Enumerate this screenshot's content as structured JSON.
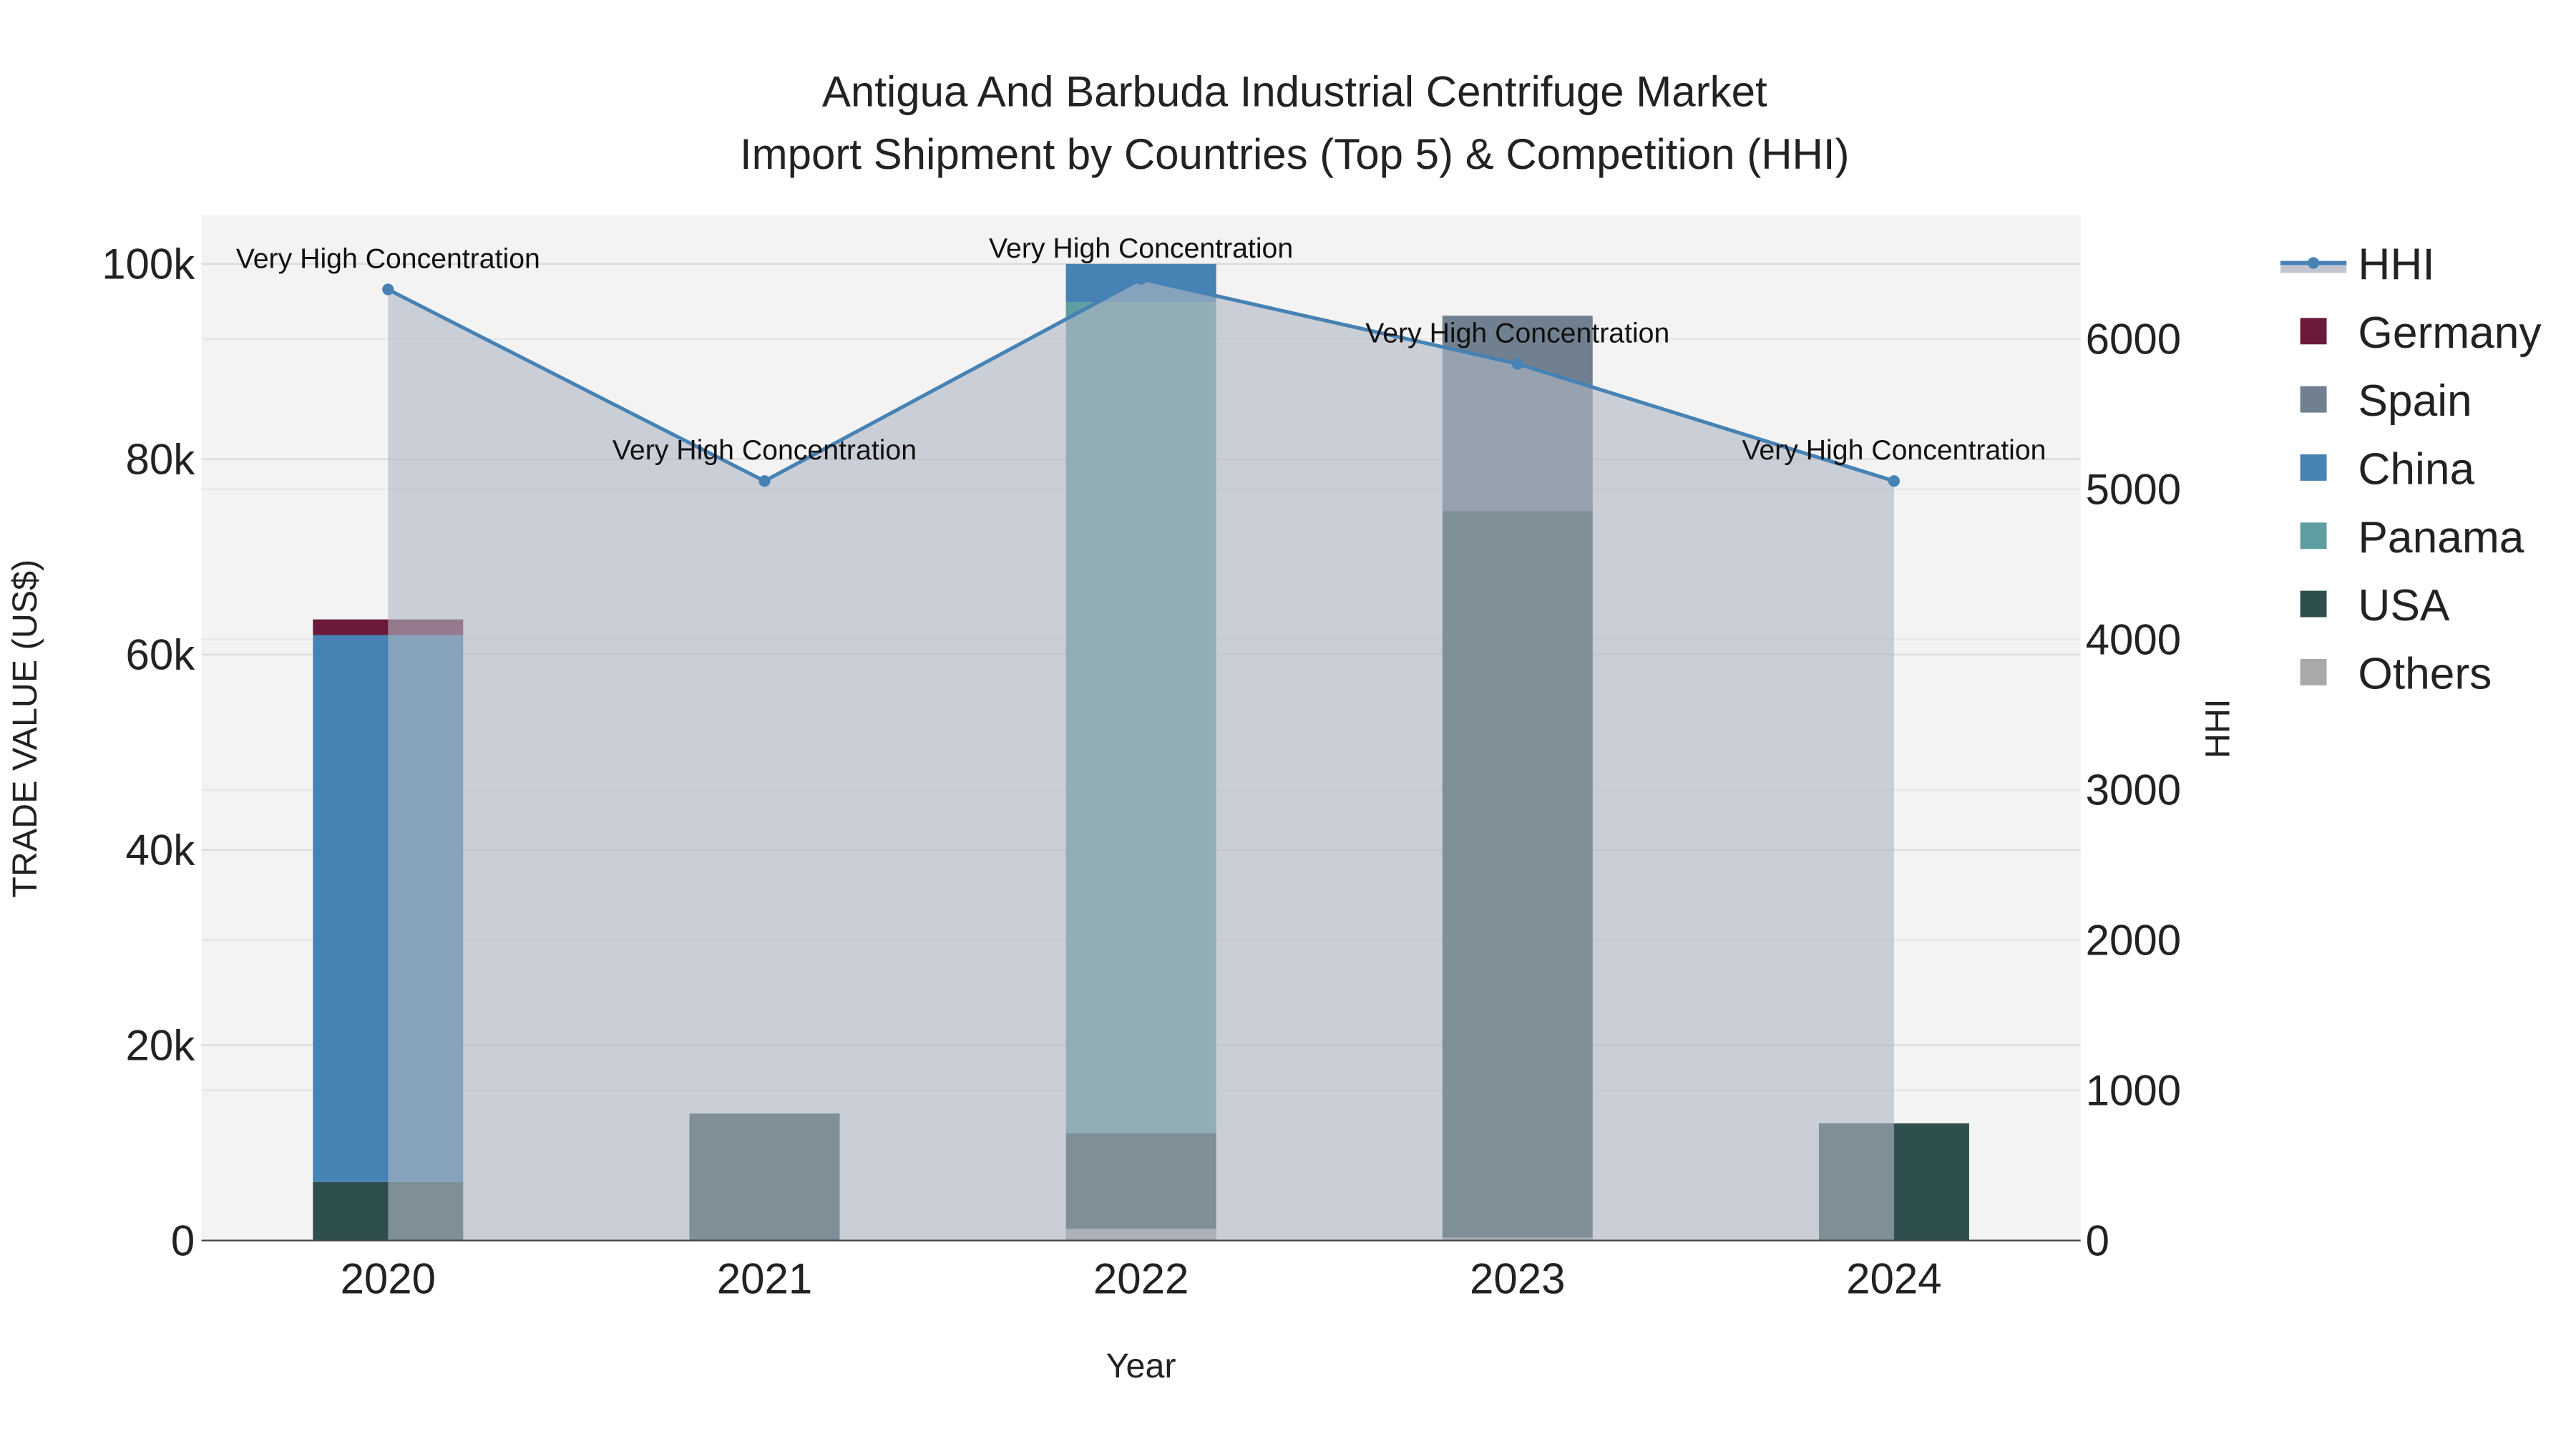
{
  "chart_data": {
    "type": "bar",
    "title_line1": "Antigua And Barbuda Industrial Centrifuge Market",
    "title_line2": "Import Shipment by Countries (Top 5) & Competition (HHI)",
    "xlabel": "Year",
    "ylabel": "TRADE VALUE (US$)",
    "y2label": "HHI",
    "categories": [
      "2020",
      "2021",
      "2022",
      "2023",
      "2024"
    ],
    "ylim": [
      0,
      105000
    ],
    "y2lim": [
      0,
      6825
    ],
    "yticks": [
      0,
      20000,
      40000,
      60000,
      80000,
      100000
    ],
    "ytick_labels": [
      "0",
      "20k",
      "40k",
      "60k",
      "80k",
      "100k"
    ],
    "y2ticks": [
      0,
      1000,
      2000,
      3000,
      4000,
      5000,
      6000
    ],
    "y2tick_labels": [
      "0",
      "1000",
      "2000",
      "3000",
      "4000",
      "5000",
      "6000"
    ],
    "stack_order": [
      "Others",
      "USA",
      "Panama",
      "China",
      "Spain",
      "Germany"
    ],
    "series": [
      {
        "name": "Germany",
        "color": "#6b1a3c",
        "values": [
          1600,
          0,
          0,
          0,
          0
        ]
      },
      {
        "name": "Spain",
        "color": "#708090",
        "values": [
          0,
          0,
          0,
          20000,
          0
        ]
      },
      {
        "name": "China",
        "color": "#4682b4",
        "values": [
          56000,
          0,
          3900,
          0,
          0
        ]
      },
      {
        "name": "Panama",
        "color": "#5f9ea0",
        "values": [
          0,
          0,
          85100,
          0,
          0
        ]
      },
      {
        "name": "USA",
        "color": "#2f4f4f",
        "values": [
          6000,
          13000,
          9800,
          74400,
          12000
        ]
      },
      {
        "name": "Others",
        "color": "#a9a9a9",
        "values": [
          0,
          0,
          1200,
          300,
          0
        ]
      }
    ],
    "hhi": {
      "name": "HHI",
      "color": "#4682b4",
      "values": [
        6330,
        5055,
        6400,
        5835,
        5055
      ],
      "annotations": [
        "Very High Concentration",
        "Very High Concentration",
        "Very High Concentration",
        "Very High Concentration",
        "Very High Concentration"
      ]
    },
    "legend": [
      "HHI",
      "Germany",
      "Spain",
      "China",
      "Panama",
      "USA",
      "Others"
    ],
    "legend_position": "right",
    "grid": true
  }
}
